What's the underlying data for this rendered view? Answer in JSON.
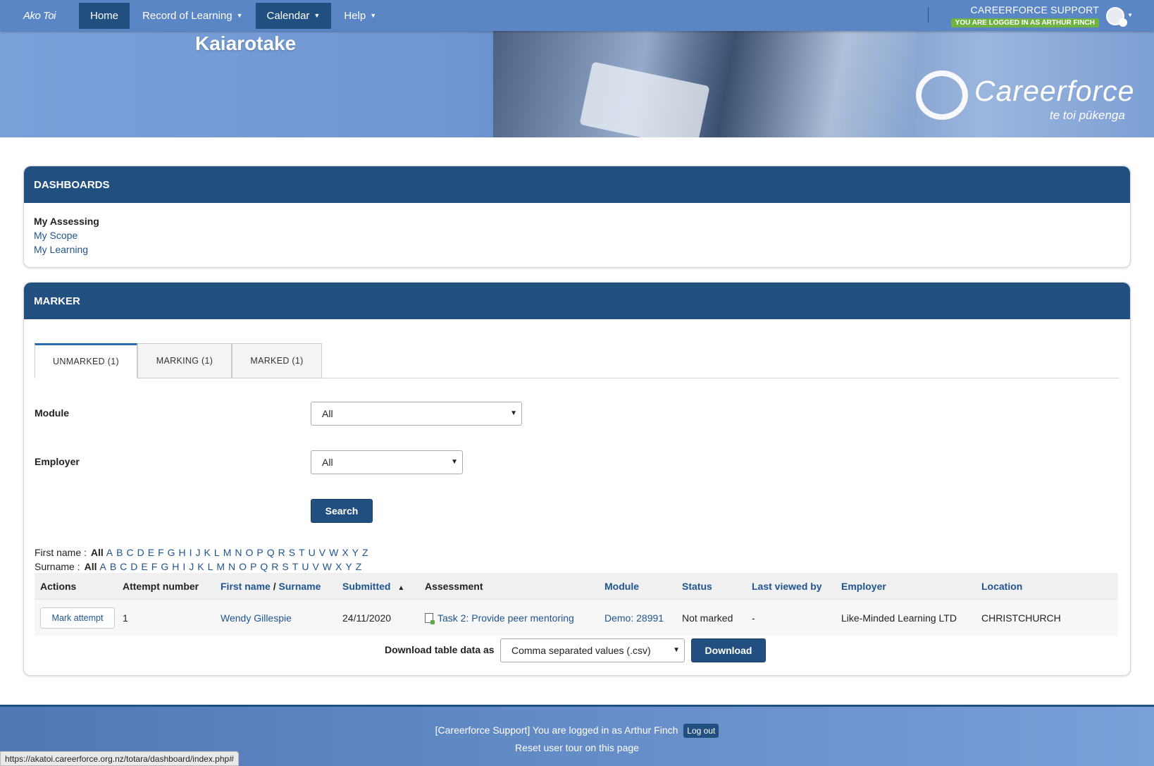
{
  "nav": {
    "logo_text": "Ako Toi",
    "items": [
      {
        "label": "Home",
        "active": true,
        "dropdown": false
      },
      {
        "label": "Record of Learning",
        "active": false,
        "dropdown": true
      },
      {
        "label": "Calendar",
        "active": true,
        "dropdown": true
      },
      {
        "label": "Help",
        "active": false,
        "dropdown": true
      }
    ],
    "user_name": "CAREERFORCE SUPPORT",
    "logged_in_badge": "YOU ARE LOGGED IN AS ARTHUR FINCH"
  },
  "banner": {
    "title": "Kaiarotake",
    "brand_name": "Careerforce",
    "brand_tagline": "te toi pūkenga"
  },
  "dashboards": {
    "header": "DASHBOARDS",
    "items": [
      {
        "label": "My Assessing",
        "current": true
      },
      {
        "label": "My Scope",
        "current": false
      },
      {
        "label": "My Learning",
        "current": false
      }
    ]
  },
  "marker": {
    "header": "MARKER",
    "tabs": [
      {
        "label": "UNMARKED (1)",
        "active": true
      },
      {
        "label": "MARKING (1)",
        "active": false
      },
      {
        "label": "MARKED (1)",
        "active": false
      }
    ],
    "module_label": "Module",
    "module_value": "All",
    "employer_label": "Employer",
    "employer_value": "All",
    "search_label": "Search",
    "firstname_label": "First name :",
    "surname_label": "Surname :",
    "all_label": "All",
    "letters": [
      "A",
      "B",
      "C",
      "D",
      "E",
      "F",
      "G",
      "H",
      "I",
      "J",
      "K",
      "L",
      "M",
      "N",
      "O",
      "P",
      "Q",
      "R",
      "S",
      "T",
      "U",
      "V",
      "W",
      "X",
      "Y",
      "Z"
    ],
    "table": {
      "headers": {
        "actions": "Actions",
        "attempt": "Attempt number",
        "firstname": "First name",
        "slash": " / ",
        "surname": "Surname",
        "submitted": "Submitted",
        "sort_indicator": "▲",
        "assessment": "Assessment",
        "module": "Module",
        "status": "Status",
        "last_viewed": "Last viewed by",
        "employer": "Employer",
        "location": "Location"
      },
      "rows": [
        {
          "action": "Mark attempt",
          "attempt": "1",
          "name": "Wendy Gillespie",
          "submitted": "24/11/2020",
          "assessment": "Task 2: Provide peer mentoring",
          "module": "Demo: 28991",
          "status": "Not marked",
          "last_viewed": "-",
          "employer": "Like-Minded Learning LTD",
          "location": "CHRISTCHURCH"
        }
      ]
    },
    "download_label": "Download table data as",
    "download_format": "Comma separated values (.csv)",
    "download_button": "Download"
  },
  "footer": {
    "logged_in_text": "[Careerforce Support] You are logged in as Arthur Finch",
    "logout_label": "Log out",
    "reset_tour": "Reset user tour on this page"
  },
  "status_url": "https://akatoi.careerforce.org.nz/totara/dashboard/index.php#",
  "colors": {
    "nav_bg": "#5a86c5",
    "primary": "#214f80",
    "link": "#1f5490",
    "badge_green": "#70b23f"
  }
}
